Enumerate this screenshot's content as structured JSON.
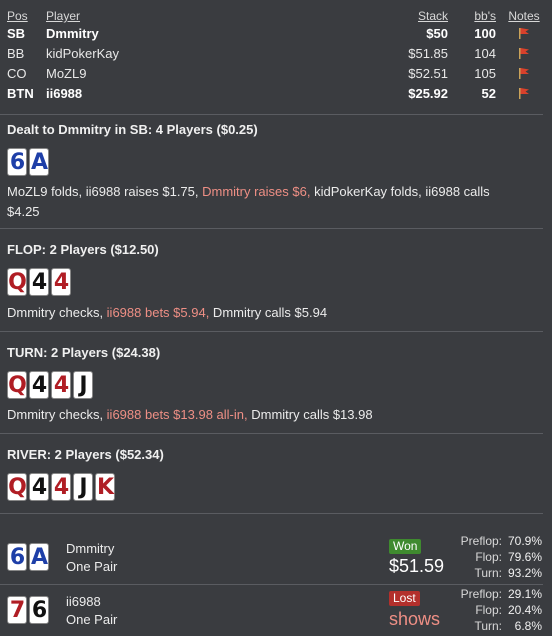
{
  "table": {
    "headers": {
      "pos": "Pos",
      "player": "Player",
      "stack": "Stack",
      "bb": "bb's",
      "notes": "Notes"
    },
    "rows": [
      {
        "pos": "SB",
        "player": "Dmmitry",
        "stack": "$50",
        "bb": "100",
        "bold": true
      },
      {
        "pos": "BB",
        "player": "kidPokerKay",
        "stack": "$51.85",
        "bb": "104",
        "bold": false
      },
      {
        "pos": "CO",
        "player": "MoZL9",
        "stack": "$52.51",
        "bb": "105",
        "bold": false
      },
      {
        "pos": "BTN",
        "player": "ii6988",
        "stack": "$25.92",
        "bb": "52",
        "bold": true
      }
    ]
  },
  "preflop": {
    "title": "Dealt to Dmmitry in SB: 4 Players ($0.25)",
    "cards": [
      {
        "rank": "6",
        "color": "blue"
      },
      {
        "rank": "A",
        "color": "blue"
      }
    ],
    "actions": {
      "a1": "MoZL9 folds, ii6988 raises $1.75, ",
      "a2": "Dmmitry raises $6,",
      "a3": " kidPokerKay folds, ii6988 calls",
      "a4": "$4.25"
    }
  },
  "flop": {
    "title": "FLOP: 2 Players ($12.50)",
    "cards": [
      {
        "rank": "Q",
        "color": "red"
      },
      {
        "rank": "4",
        "color": "black"
      },
      {
        "rank": "4",
        "color": "red"
      }
    ],
    "actions": {
      "a1": "Dmmitry checks, ",
      "a2": "ii6988 bets $5.94,",
      "a3": " Dmmitry calls $5.94"
    }
  },
  "turn": {
    "title": "TURN: 2 Players ($24.38)",
    "cards": [
      {
        "rank": "Q",
        "color": "red"
      },
      {
        "rank": "4",
        "color": "black"
      },
      {
        "rank": "4",
        "color": "red"
      },
      {
        "rank": "J",
        "color": "black"
      }
    ],
    "actions": {
      "a1": "Dmmitry checks, ",
      "a2": "ii6988 bets $13.98 all-in,",
      "a3": " Dmmitry calls $13.98"
    }
  },
  "river": {
    "title": "RIVER: 2 Players ($52.34)",
    "cards": [
      {
        "rank": "Q",
        "color": "red"
      },
      {
        "rank": "4",
        "color": "black"
      },
      {
        "rank": "4",
        "color": "red"
      },
      {
        "rank": "J",
        "color": "black"
      },
      {
        "rank": "K",
        "color": "red"
      }
    ]
  },
  "results": [
    {
      "cards": [
        {
          "rank": "6",
          "color": "blue"
        },
        {
          "rank": "A",
          "color": "blue"
        }
      ],
      "name": "Dmmitry",
      "hand": "One Pair",
      "badge": "Won",
      "amount": "$51.59",
      "equity": {
        "preflop_label": "Preflop:",
        "preflop": "70.9%",
        "flop_label": "Flop:",
        "flop": "79.6%",
        "turn_label": "Turn:",
        "turn": "93.2%"
      }
    },
    {
      "cards": [
        {
          "rank": "7",
          "color": "red"
        },
        {
          "rank": "6",
          "color": "black"
        }
      ],
      "name": "ii6988",
      "hand": "One Pair",
      "badge": "Lost",
      "amount": "shows",
      "equity": {
        "preflop_label": "Preflop:",
        "preflop": "29.1%",
        "flop_label": "Flop:",
        "flop": "20.4%",
        "turn_label": "Turn:",
        "turn": "6.8%"
      }
    }
  ],
  "colors": {
    "background": "#3a3c40",
    "highlight": "#ee8f85",
    "won": "#3f8a2f",
    "lost": "#b3302c",
    "card_blue": "#1e3fa8",
    "card_red": "#b01d24"
  }
}
